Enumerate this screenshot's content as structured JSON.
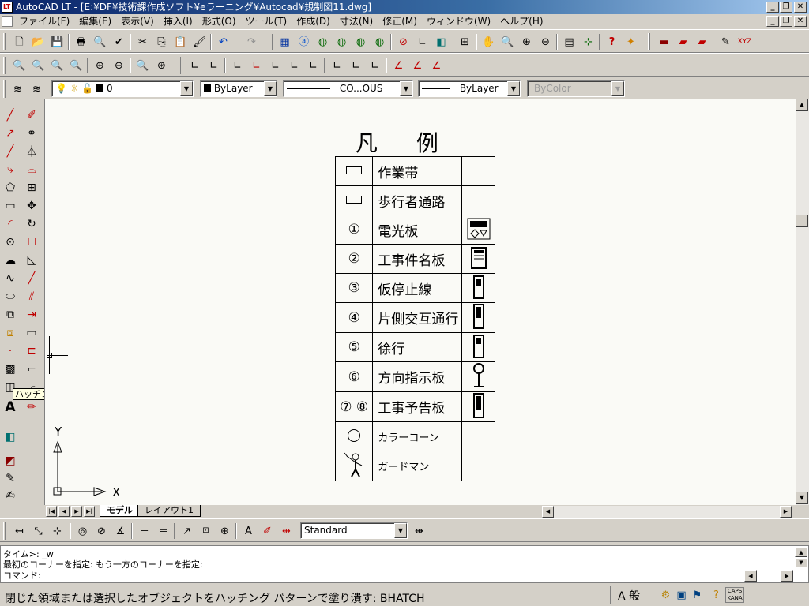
{
  "window": {
    "title": "AutoCAD LT - [E:¥DF¥技術課作成ソフト¥eラーニング¥Autocad¥規制図11.dwg]",
    "min": "_",
    "restore": "❐",
    "close": "✕"
  },
  "menu": {
    "items": [
      "ファイル(F)",
      "編集(E)",
      "表示(V)",
      "挿入(I)",
      "形式(O)",
      "ツール(T)",
      "作成(D)",
      "寸法(N)",
      "修正(M)",
      "ウィンドウ(W)",
      "ヘルプ(H)"
    ]
  },
  "properties": {
    "layer": "0",
    "color": "ByLayer",
    "linetype": "CO...OUS",
    "lineweight": "ByLayer",
    "plotstyle": "ByColor"
  },
  "tooltip": "ハッチング",
  "legend": {
    "title": "凡 例",
    "rows": [
      {
        "symbol": "rect",
        "label": "作業帯"
      },
      {
        "symbol": "rect",
        "label": "歩行者通路"
      },
      {
        "symbol": "①",
        "label": "電光板"
      },
      {
        "symbol": "②",
        "label": "工事件名板"
      },
      {
        "symbol": "③",
        "label": "仮停止線"
      },
      {
        "symbol": "④",
        "label": "片側交互通行"
      },
      {
        "symbol": "⑤",
        "label": "徐行"
      },
      {
        "symbol": "⑥",
        "label": "方向指示板"
      },
      {
        "symbol": "⑦ ⑧",
        "label": "工事予告板"
      },
      {
        "symbol": "circle",
        "label": "カラーコーン"
      },
      {
        "symbol": "person",
        "label": "ガードマン"
      }
    ]
  },
  "ucs": {
    "x": "X",
    "y": "Y"
  },
  "tabs": {
    "model": "モデル",
    "layout": "レイアウト1"
  },
  "dimstyle": "Standard",
  "command": {
    "lines": [
      "タイム>: _w",
      "最初のコーナーを指定: もう一方のコーナーを指定:",
      "コマンド:"
    ]
  },
  "status": {
    "message": "閉じた領域または選択したオブジェクトをハッチング パターンで塗り潰す: BHATCH",
    "ime": "A 般"
  }
}
